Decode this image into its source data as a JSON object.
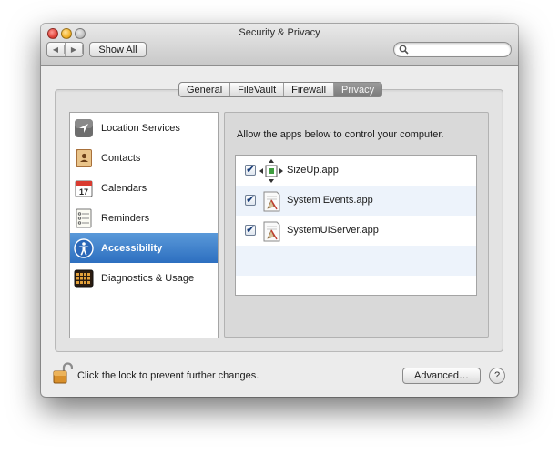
{
  "window": {
    "title": "Security & Privacy",
    "show_all": "Show All",
    "search_placeholder": ""
  },
  "tabs": [
    {
      "label": "General",
      "active": false
    },
    {
      "label": "FileVault",
      "active": false
    },
    {
      "label": "Firewall",
      "active": false
    },
    {
      "label": "Privacy",
      "active": true
    }
  ],
  "sidebar": {
    "items": [
      {
        "label": "Location Services",
        "icon": "location-arrow-icon",
        "selected": false
      },
      {
        "label": "Contacts",
        "icon": "contacts-book-icon",
        "selected": false
      },
      {
        "label": "Calendars",
        "icon": "calendar-icon",
        "selected": false
      },
      {
        "label": "Reminders",
        "icon": "reminders-list-icon",
        "selected": false
      },
      {
        "label": "Accessibility",
        "icon": "accessibility-icon",
        "selected": true
      },
      {
        "label": "Diagnostics & Usage",
        "icon": "diagnostics-icon",
        "selected": false
      }
    ],
    "calendar_day": "17"
  },
  "privacy": {
    "description": "Allow the apps below to control your computer.",
    "apps": [
      {
        "label": "SizeUp.app",
        "checked": true,
        "icon": "sizeup-icon"
      },
      {
        "label": "System Events.app",
        "checked": true,
        "icon": "script-app-icon"
      },
      {
        "label": "SystemUIServer.app",
        "checked": true,
        "icon": "script-app-icon"
      }
    ]
  },
  "footer": {
    "lock_text": "Click the lock to prevent further changes.",
    "advanced_button": "Advanced…",
    "help_button": "?"
  },
  "colors": {
    "selection": "#2d6fc0",
    "window_bg": "#ececec",
    "alt_row": "#edf3fb"
  }
}
